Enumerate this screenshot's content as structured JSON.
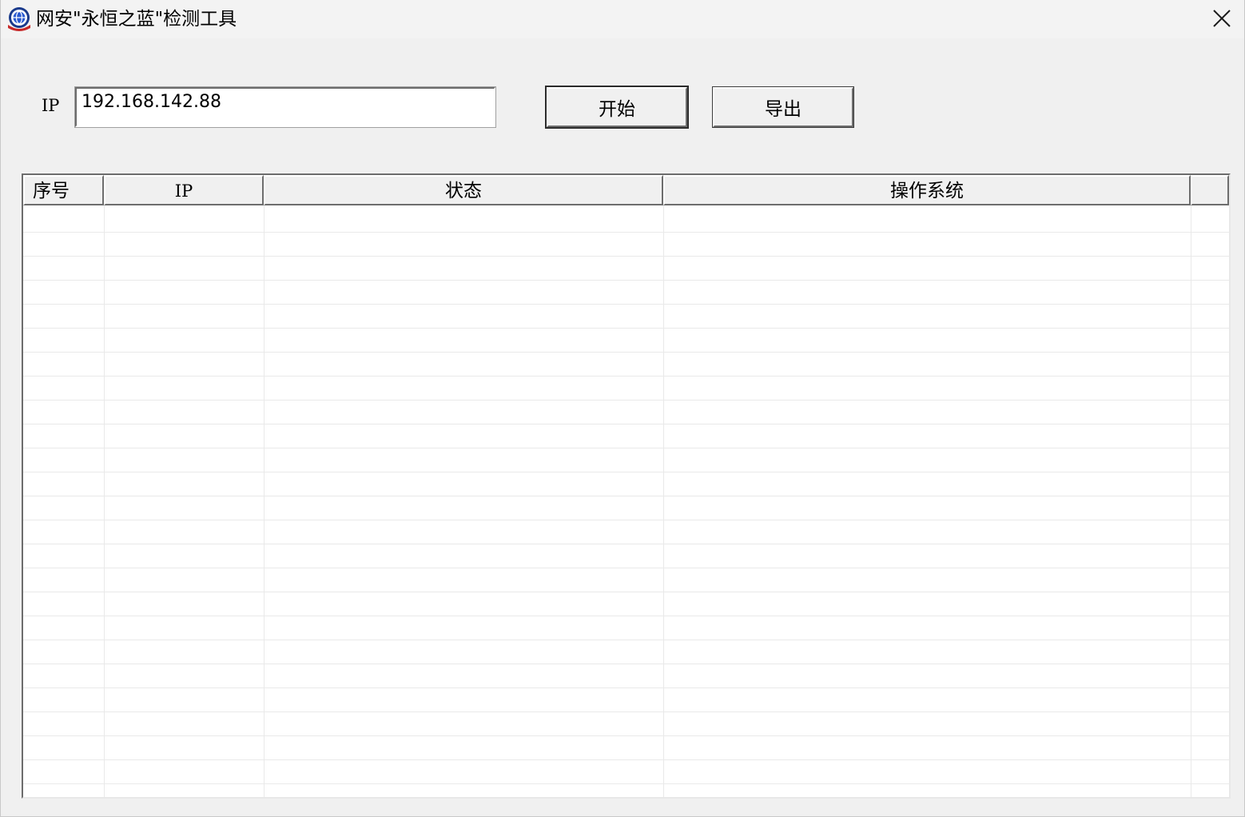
{
  "window": {
    "title": "网安\"永恒之蓝\"检测工具",
    "close_symbol": "✕",
    "icon": "shield-globe-icon"
  },
  "form": {
    "ip_label": "IP",
    "ip_value": "192.168.142.88",
    "start_label": "开始",
    "export_label": "导出"
  },
  "table": {
    "columns": [
      {
        "label": "序号"
      },
      {
        "label": "IP"
      },
      {
        "label": "状态"
      },
      {
        "label": "操作系统"
      },
      {
        "label": ""
      }
    ],
    "rows": []
  }
}
